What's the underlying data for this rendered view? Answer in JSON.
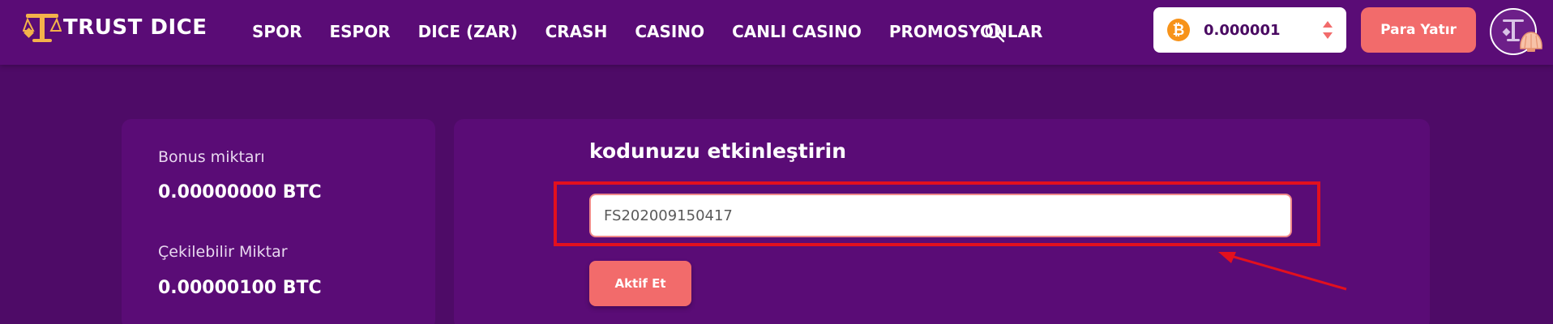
{
  "header": {
    "logo_text": "TRUST DICE",
    "nav": [
      "SPOR",
      "ESPOR",
      "DICE (ZAR)",
      "CRASH",
      "CASINO",
      "CANLI CASINO",
      "PROMOSYONLAR"
    ],
    "wallet": {
      "currency_symbol": "₿",
      "balance": "0.000001"
    },
    "deposit_label": "Para Yatır"
  },
  "stats": {
    "bonus_label": "Bonus miktarı",
    "bonus_value": "0.00000000 BTC",
    "withdrawable_label": "Çekilebilir Miktar",
    "withdrawable_value": "0.00000100 BTC"
  },
  "redeem": {
    "title": "kodunuzu etkinleştirin",
    "code_value": "FS202009150417",
    "activate_label": "Aktif Et"
  },
  "colors": {
    "background": "#4e0b67",
    "card": "#5a0c76",
    "accent": "#f26b6b",
    "highlight": "#e3101e",
    "bitcoin": "#f7931a"
  }
}
